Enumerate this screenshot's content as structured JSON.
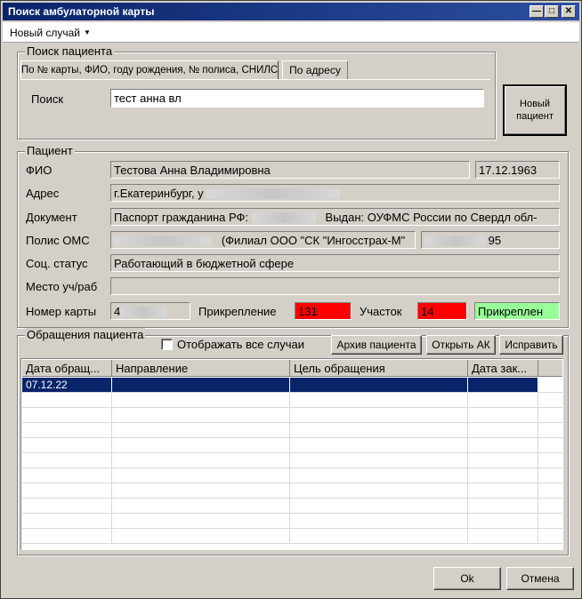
{
  "window": {
    "title": "Поиск амбулаторной карты"
  },
  "menu": {
    "new_case": "Новый случай"
  },
  "search": {
    "group_title": "Поиск пациента",
    "tabs": [
      "По № карты, ФИО, году рождения, № полиса, СНИЛС",
      "По адресу"
    ],
    "label": "Поиск",
    "value": "тест анна вл",
    "new_patient_button": "Новый пациент"
  },
  "patient": {
    "group_title": "Пациент",
    "fio_label": "ФИО",
    "fio": "Тестова Анна Владимировна",
    "birth_date": "17.12.1963",
    "address_label": "Адрес",
    "address": "г.Екатеринбург, у",
    "document_label": "Документ",
    "document": "Паспорт гражданина РФ:",
    "document_issued": "Выдан: ОУФМС России по Свердл обл-",
    "policy_label": "Полис ОМС",
    "policy_insurer": "(Филиал ООО \"СК \"Ингосстрах-М\"",
    "policy_suffix": "95",
    "social_label": "Соц. статус",
    "social": "Работающий в бюджетной сфере",
    "workplace_label": "Место уч/раб",
    "workplace": "",
    "card_label": "Номер карты",
    "card_number": "4",
    "attach_label": "Прикрепление",
    "attach_value": "131",
    "district_label": "Участок",
    "district_value": "14",
    "status_value": "Прикреплен"
  },
  "visits": {
    "group_title": "Обращения пациента",
    "show_all_label": "Отображать все случаи",
    "archive_button": "Архив пациента",
    "open_ak_button": "Открыть АК",
    "fix_button": "Исправить",
    "columns": [
      "Дата обращ...",
      "Направление",
      "Цель обращения",
      "Дата зак..."
    ],
    "rows": [
      [
        "07.12.22",
        "",
        "",
        ""
      ]
    ]
  },
  "footer": {
    "ok": "Ok",
    "cancel": "Отмена"
  },
  "colors": {
    "title_bar": "#0a246a",
    "selection": "#0a246a",
    "alert_red": "#ff0000",
    "attached_green": "#99ff99"
  }
}
